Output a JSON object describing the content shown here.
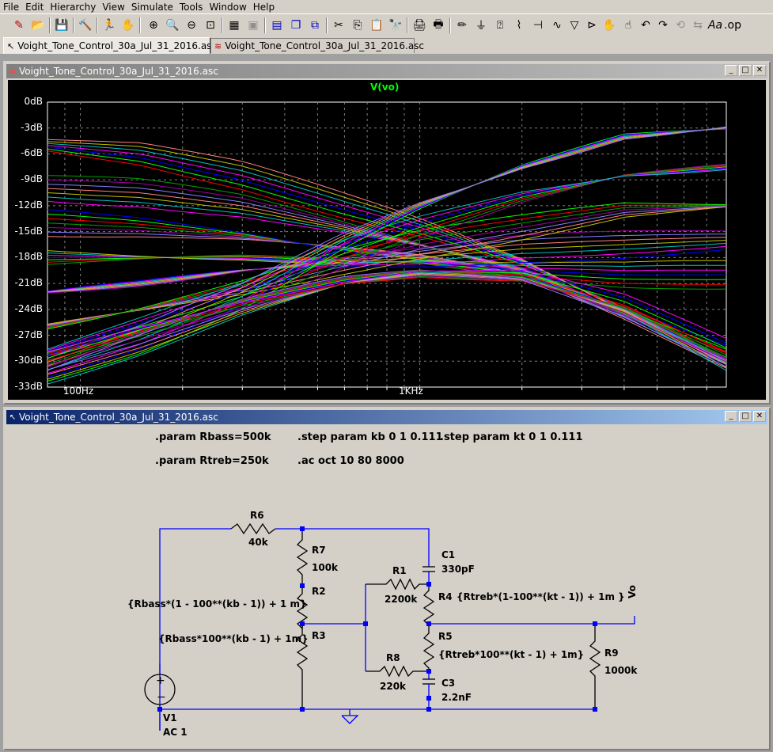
{
  "menu": [
    {
      "label": "File"
    },
    {
      "label": "Edit"
    },
    {
      "label": "Hierarchy"
    },
    {
      "label": "View"
    },
    {
      "label": "Simulate"
    },
    {
      "label": "Tools"
    },
    {
      "label": "Window"
    },
    {
      "label": "Help"
    }
  ],
  "tabs": [
    {
      "label": "Voight_Tone_Control_30a_Jul_31_2016.asc",
      "icon": "schematic-icon"
    },
    {
      "label": "Voight_Tone_Control_30a_Jul_31_2016.asc",
      "icon": "waveform-icon"
    }
  ],
  "plot_window": {
    "title": "Voight_Tone_Control_30a_Jul_31_2016.asc",
    "trace": "V(vo)",
    "trace_color": "#00ff00"
  },
  "schematic_window": {
    "title": "Voight_Tone_Control_30a_Jul_31_2016.asc"
  },
  "directives": {
    "param_rbass": ".param Rbass=500k",
    "param_rtreb": ".param Rtreb=250k",
    "step_kb": ".step param kb 0 1 0.111",
    "step_kt": ".step param kt 0 1 0.111",
    "ac": ".ac oct 10 80 8000"
  },
  "components": {
    "r6_name": "R6",
    "r6_value": "40k",
    "r7_name": "R7",
    "r7_value": "100k",
    "r2_name": "R2",
    "r2_value": "{Rbass*(1 - 100**(kb - 1)) + 1 m}",
    "r3_name": "R3",
    "r3_value": "{Rbass*100**(kb - 1) + 1m}",
    "r1_name": "R1",
    "r1_value": "2200k",
    "r4_name": "R4",
    "r4_value": "{Rtreb*(1-100**(kt - 1)) + 1m }",
    "r5_name": "R5",
    "r5_value": "{Rtreb*100**(kt - 1) + 1m}",
    "r8_name": "R8",
    "r8_value": "220k",
    "r9_name": "R9",
    "r9_value": "1000k",
    "c1_name": "C1",
    "c1_value": "330pF",
    "c3_name": "C3",
    "c3_value": "2.2nF",
    "v1_name": "V1",
    "v1_value": "AC 1",
    "net_vo": "Vo"
  },
  "chart_data": {
    "type": "line",
    "title": "V(vo)",
    "xscale": "log",
    "xlim": [
      80,
      8000
    ],
    "ylim": [
      -33,
      0
    ],
    "y_ticks": [
      "0dB",
      "-3dB",
      "-6dB",
      "-9dB",
      "-12dB",
      "-15dB",
      "-18dB",
      "-21dB",
      "-24dB",
      "-27dB",
      "-30dB",
      "-33dB"
    ],
    "x_ticks": [
      "100Hz",
      "1KHz"
    ],
    "grid": true,
    "series_colors": [
      "#ff0000",
      "#00ff00",
      "#0000ff",
      "#ff00ff",
      "#00c0c0",
      "#c0c000",
      "#ff8080",
      "#8080ff",
      "#a000a0",
      "#00a000"
    ],
    "families": [
      {
        "x": [
          80,
          150,
          300,
          600,
          1000,
          2000,
          4000,
          8000
        ],
        "values": [
          -5,
          -6,
          -8.5,
          -12,
          -14.5,
          -18.5,
          -24,
          -30
        ]
      },
      {
        "x": [
          80,
          150,
          300,
          600,
          1000,
          2000,
          4000,
          8000
        ],
        "values": [
          -10,
          -10.5,
          -12,
          -14.5,
          -16.5,
          -19.5,
          -24.5,
          -30
        ]
      },
      {
        "x": [
          80,
          150,
          300,
          600,
          1000,
          2000,
          4000,
          8000
        ],
        "values": [
          -14,
          -14.5,
          -15.5,
          -17,
          -18,
          -20,
          -24.5,
          -29.5
        ]
      },
      {
        "x": [
          80,
          150,
          300,
          600,
          1000,
          2000,
          4000,
          8000
        ],
        "values": [
          -18,
          -18,
          -18,
          -18.5,
          -18.5,
          -19.5,
          -20,
          -20
        ]
      },
      {
        "x": [
          80,
          150,
          300,
          600,
          1000,
          2000,
          4000,
          8000
        ],
        "values": [
          -22,
          -21,
          -19.5,
          -18.5,
          -18,
          -17,
          -16.5,
          -16
        ]
      },
      {
        "x": [
          80,
          150,
          300,
          600,
          1000,
          2000,
          4000,
          8000
        ],
        "values": [
          -26,
          -24,
          -21.5,
          -18.5,
          -16.5,
          -14.5,
          -12.5,
          -12
        ]
      },
      {
        "x": [
          80,
          150,
          300,
          600,
          1000,
          2000,
          4000,
          8000
        ],
        "values": [
          -29,
          -26,
          -22.5,
          -17.5,
          -14.5,
          -11,
          -8.5,
          -7.5
        ]
      },
      {
        "x": [
          80,
          150,
          300,
          600,
          1000,
          2000,
          4000,
          8000
        ],
        "values": [
          -31,
          -27.5,
          -22.5,
          -16,
          -12,
          -7.5,
          -4,
          -3
        ]
      },
      {
        "x": [
          80,
          150,
          300,
          600,
          1000,
          2000,
          4000,
          8000
        ],
        "values": [
          -31,
          -28,
          -24,
          -21,
          -20,
          -20.5,
          -24,
          -30
        ]
      },
      {
        "x": [
          80,
          150,
          300,
          600,
          1000,
          2000,
          4000,
          8000
        ],
        "values": [
          -30,
          -26.5,
          -23,
          -20.5,
          -19.5,
          -20,
          -23.5,
          -29
        ]
      }
    ]
  }
}
